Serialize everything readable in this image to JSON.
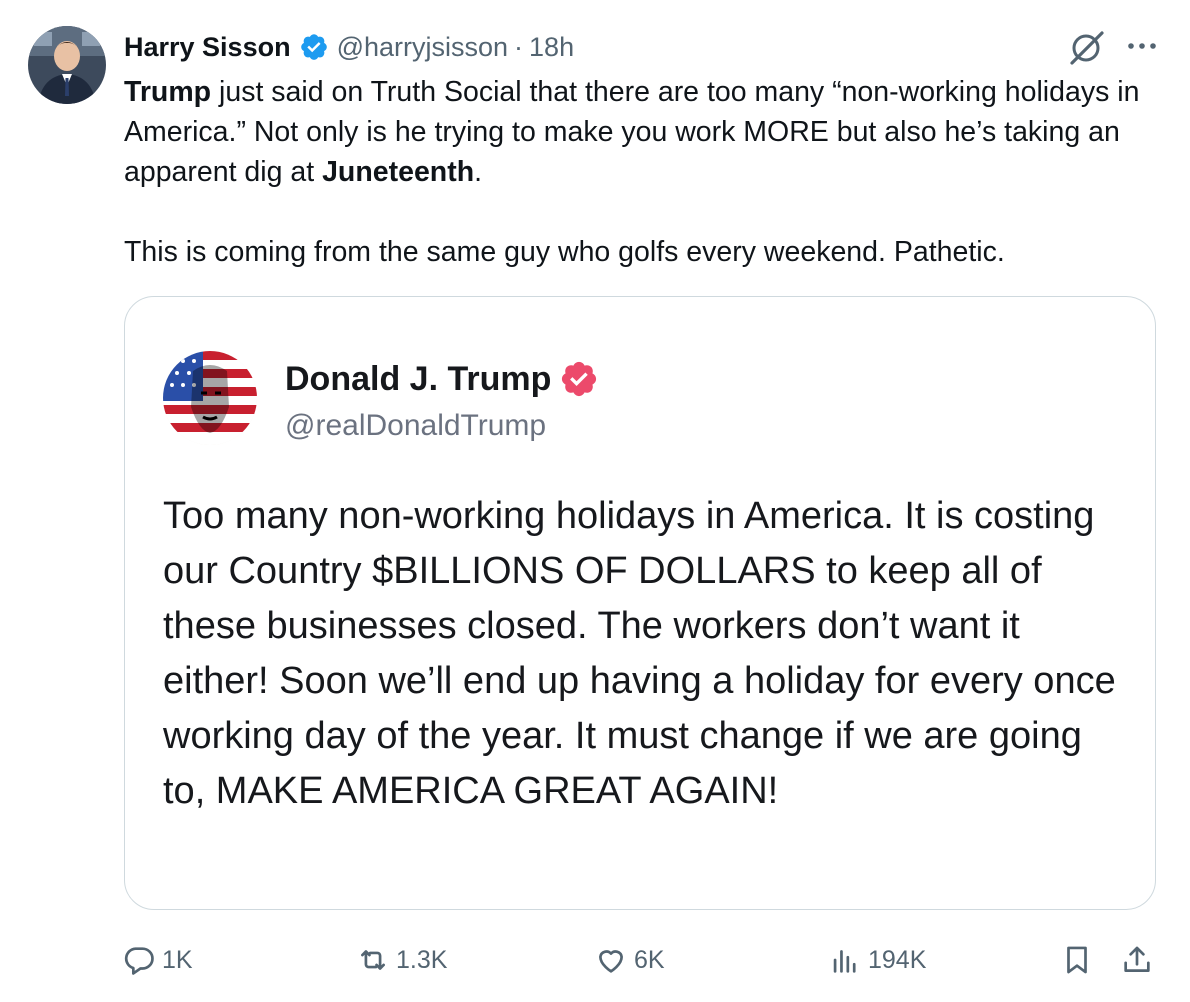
{
  "author": {
    "name": "Harry Sisson",
    "handle": "@harryjsisson",
    "separator": "·",
    "time": "18h",
    "verified_color": "#1d9bf0"
  },
  "tweet": {
    "line1_bold": "Trump",
    "line1_rest": " just said on Truth Social that there are too many “non-working holidays in America.” Not only is he trying to make you work MORE but also he’s taking an apparent dig at ",
    "line1_bold2": "Juneteenth",
    "line1_end": ".",
    "line2": "This is coming from the same guy who golfs every weekend. Pathetic."
  },
  "quote": {
    "name": "Donald J. Trump",
    "handle": "@realDonaldTrump",
    "badge_color": "#ec4a6b",
    "body": "Too many non-working holidays in America. It is costing our Country $BILLIONS OF DOLLARS to keep all of these businesses closed. The workers don’t want it either! Soon we’ll end up having a holiday for every once working day of the year. It must change if we are going to, MAKE AMERICA GREAT AGAIN!"
  },
  "actions": {
    "reply_count": "1K",
    "repost_count": "1.3K",
    "like_count": "6K",
    "views_count": "194K"
  },
  "icons": [
    "grok-icon",
    "more-icon",
    "reply-icon",
    "repost-icon",
    "like-icon",
    "views-icon",
    "bookmark-icon",
    "share-icon",
    "verified-icon"
  ]
}
